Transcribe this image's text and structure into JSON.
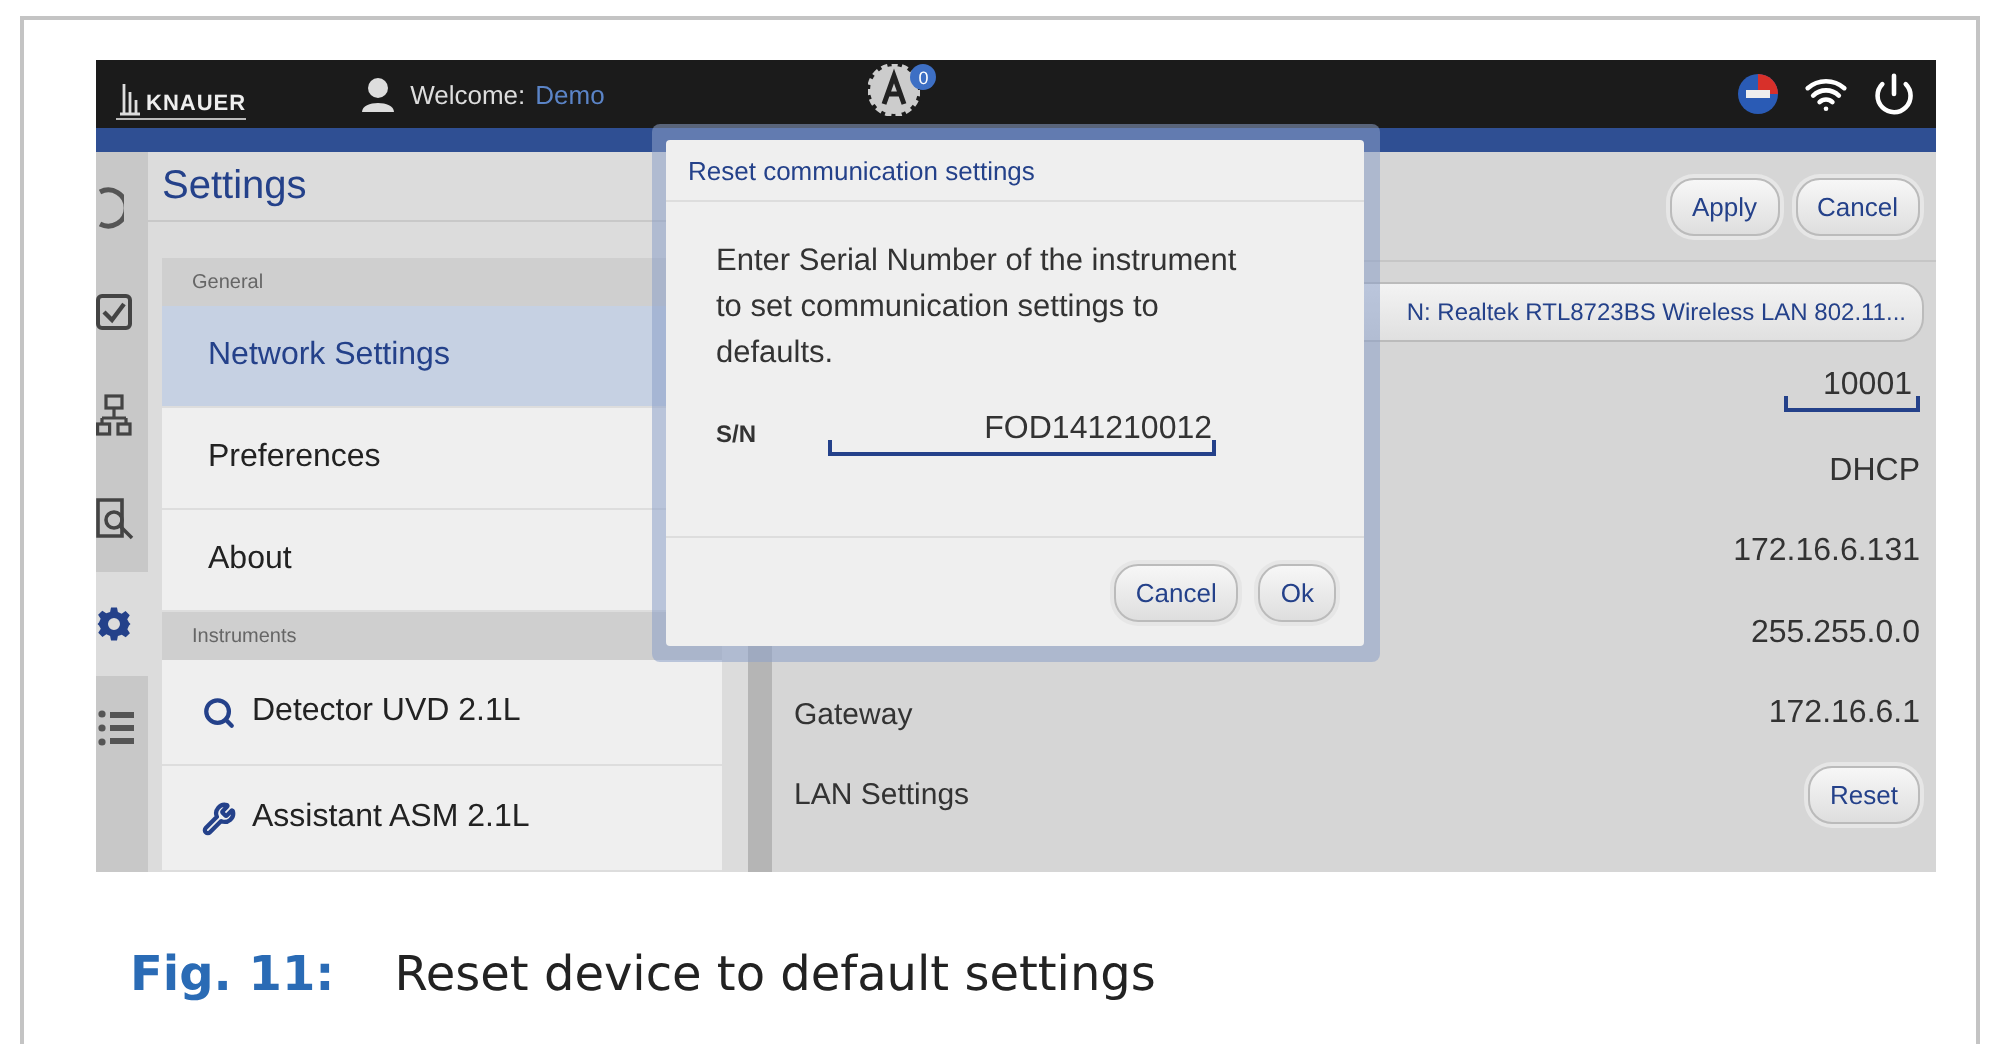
{
  "header": {
    "logo": "KNAUER",
    "welcome_label": "Welcome:",
    "user": "Demo",
    "badge": "0"
  },
  "rail": [
    {
      "kind": "circle",
      "selected": false
    },
    {
      "kind": "checkbox",
      "selected": false
    },
    {
      "kind": "network",
      "selected": false
    },
    {
      "kind": "search",
      "selected": false
    },
    {
      "kind": "gear",
      "selected": true
    },
    {
      "kind": "list",
      "selected": false
    }
  ],
  "page_title": "Settings",
  "sections": [
    {
      "heading": "General",
      "items": [
        {
          "label": "Network Settings",
          "kind": "plain",
          "selected": true
        },
        {
          "label": "Preferences",
          "kind": "plain",
          "selected": false
        },
        {
          "label": "About",
          "kind": "plain",
          "selected": false
        }
      ]
    },
    {
      "heading": "Instruments",
      "items": [
        {
          "label": "Detector UVD 2.1L",
          "kind": "detector",
          "selected": false
        },
        {
          "label": "Assistant ASM 2.1L",
          "kind": "assistant",
          "selected": false
        }
      ]
    }
  ],
  "actions": [
    "Apply",
    "Cancel"
  ],
  "adapter": "N: Realtek RTL8723BS Wireless LAN 802.11...",
  "rows": [
    {
      "kind": "field",
      "value": "10001"
    },
    {
      "kind": "text",
      "value": "DHCP"
    },
    {
      "kind": "text",
      "value": "172.16.6.131"
    },
    {
      "kind": "text",
      "value": "255.255.0.0"
    },
    {
      "kind": "text",
      "label": "Gateway",
      "value": "172.16.6.1"
    },
    {
      "kind": "button",
      "label": "LAN Settings",
      "value": "Reset"
    }
  ],
  "dialog": {
    "title": "Reset communication settings",
    "message": "Enter Serial Number of the instrument to set communication settings to defaults.",
    "field_label": "S/N",
    "value": "FOD141210012",
    "buttons": [
      "Cancel",
      "Ok"
    ]
  },
  "caption": {
    "number": "Fig. 11:",
    "text": "Reset device to default settings"
  }
}
